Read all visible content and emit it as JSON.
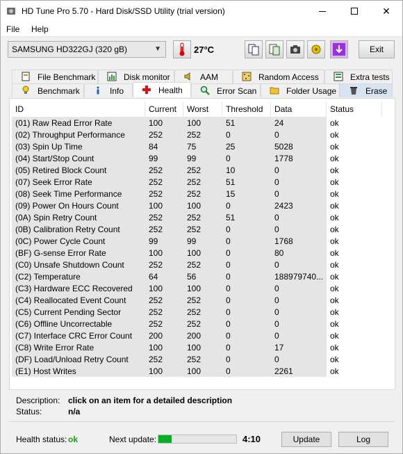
{
  "window": {
    "title": "HD Tune Pro 5.70 - Hard Disk/SSD Utility (trial version)"
  },
  "menu": {
    "file": "File",
    "help": "Help"
  },
  "toolbar": {
    "drive": "SAMSUNG HD322GJ (320 gB)",
    "temperature": "27°C",
    "exit": "Exit"
  },
  "tabs_row1": [
    {
      "label": "File Benchmark",
      "icon": "file-benchmark-icon"
    },
    {
      "label": "Disk monitor",
      "icon": "disk-monitor-icon"
    },
    {
      "label": "AAM",
      "icon": "speaker-icon"
    },
    {
      "label": "Random Access",
      "icon": "random-access-icon"
    },
    {
      "label": "Extra tests",
      "icon": "extra-tests-icon"
    }
  ],
  "tabs_row2": [
    {
      "label": "Benchmark",
      "icon": "lightbulb-icon"
    },
    {
      "label": "Info",
      "icon": "info-icon"
    },
    {
      "label": "Health",
      "icon": "health-cross-icon",
      "active": true
    },
    {
      "label": "Error Scan",
      "icon": "magnifier-icon"
    },
    {
      "label": "Folder Usage",
      "icon": "folder-icon"
    },
    {
      "label": "Erase",
      "icon": "trash-icon"
    }
  ],
  "table": {
    "headers": [
      "ID",
      "Current",
      "Worst",
      "Threshold",
      "Data",
      "Status"
    ],
    "rows": [
      [
        "(01) Raw Read Error Rate",
        "100",
        "100",
        "51",
        "24",
        "ok"
      ],
      [
        "(02) Throughput Performance",
        "252",
        "252",
        "0",
        "0",
        "ok"
      ],
      [
        "(03) Spin Up Time",
        "84",
        "75",
        "25",
        "5028",
        "ok"
      ],
      [
        "(04) Start/Stop Count",
        "99",
        "99",
        "0",
        "1778",
        "ok"
      ],
      [
        "(05) Retired Block Count",
        "252",
        "252",
        "10",
        "0",
        "ok"
      ],
      [
        "(07) Seek Error Rate",
        "252",
        "252",
        "51",
        "0",
        "ok"
      ],
      [
        "(08) Seek Time Performance",
        "252",
        "252",
        "15",
        "0",
        "ok"
      ],
      [
        "(09) Power On Hours Count",
        "100",
        "100",
        "0",
        "2423",
        "ok"
      ],
      [
        "(0A) Spin Retry Count",
        "252",
        "252",
        "51",
        "0",
        "ok"
      ],
      [
        "(0B) Calibration Retry Count",
        "252",
        "252",
        "0",
        "0",
        "ok"
      ],
      [
        "(0C) Power Cycle Count",
        "99",
        "99",
        "0",
        "1768",
        "ok"
      ],
      [
        "(BF) G-sense Error Rate",
        "100",
        "100",
        "0",
        "80",
        "ok"
      ],
      [
        "(C0) Unsafe Shutdown Count",
        "252",
        "252",
        "0",
        "0",
        "ok"
      ],
      [
        "(C2) Temperature",
        "64",
        "56",
        "0",
        "188979740...",
        "ok"
      ],
      [
        "(C3) Hardware ECC Recovered",
        "100",
        "100",
        "0",
        "0",
        "ok"
      ],
      [
        "(C4) Reallocated Event Count",
        "252",
        "252",
        "0",
        "0",
        "ok"
      ],
      [
        "(C5) Current Pending Sector",
        "252",
        "252",
        "0",
        "0",
        "ok"
      ],
      [
        "(C6) Offline Uncorrectable",
        "252",
        "252",
        "0",
        "0",
        "ok"
      ],
      [
        "(C7) Interface CRC Error Count",
        "200",
        "200",
        "0",
        "0",
        "ok"
      ],
      [
        "(C8) Write Error Rate",
        "100",
        "100",
        "0",
        "17",
        "ok"
      ],
      [
        "(DF) Load/Unload Retry Count",
        "252",
        "252",
        "0",
        "0",
        "ok"
      ],
      [
        "(E1) Host Writes",
        "100",
        "100",
        "0",
        "2261",
        "ok"
      ]
    ]
  },
  "details": {
    "description_label": "Description:",
    "description_value": "click on an item for a detailed description",
    "status_label": "Status:",
    "status_value": "n/a"
  },
  "footer": {
    "health_label": "Health status:",
    "health_value": "ok",
    "next_update_label": "Next update:",
    "progress_fraction": 0.17,
    "timer": "4:10",
    "update_button": "Update",
    "log_button": "Log"
  },
  "colors": {
    "ok_green": "#1a9c1a",
    "progress_green": "#06b025",
    "erase_tab": "#d8e4f0"
  }
}
